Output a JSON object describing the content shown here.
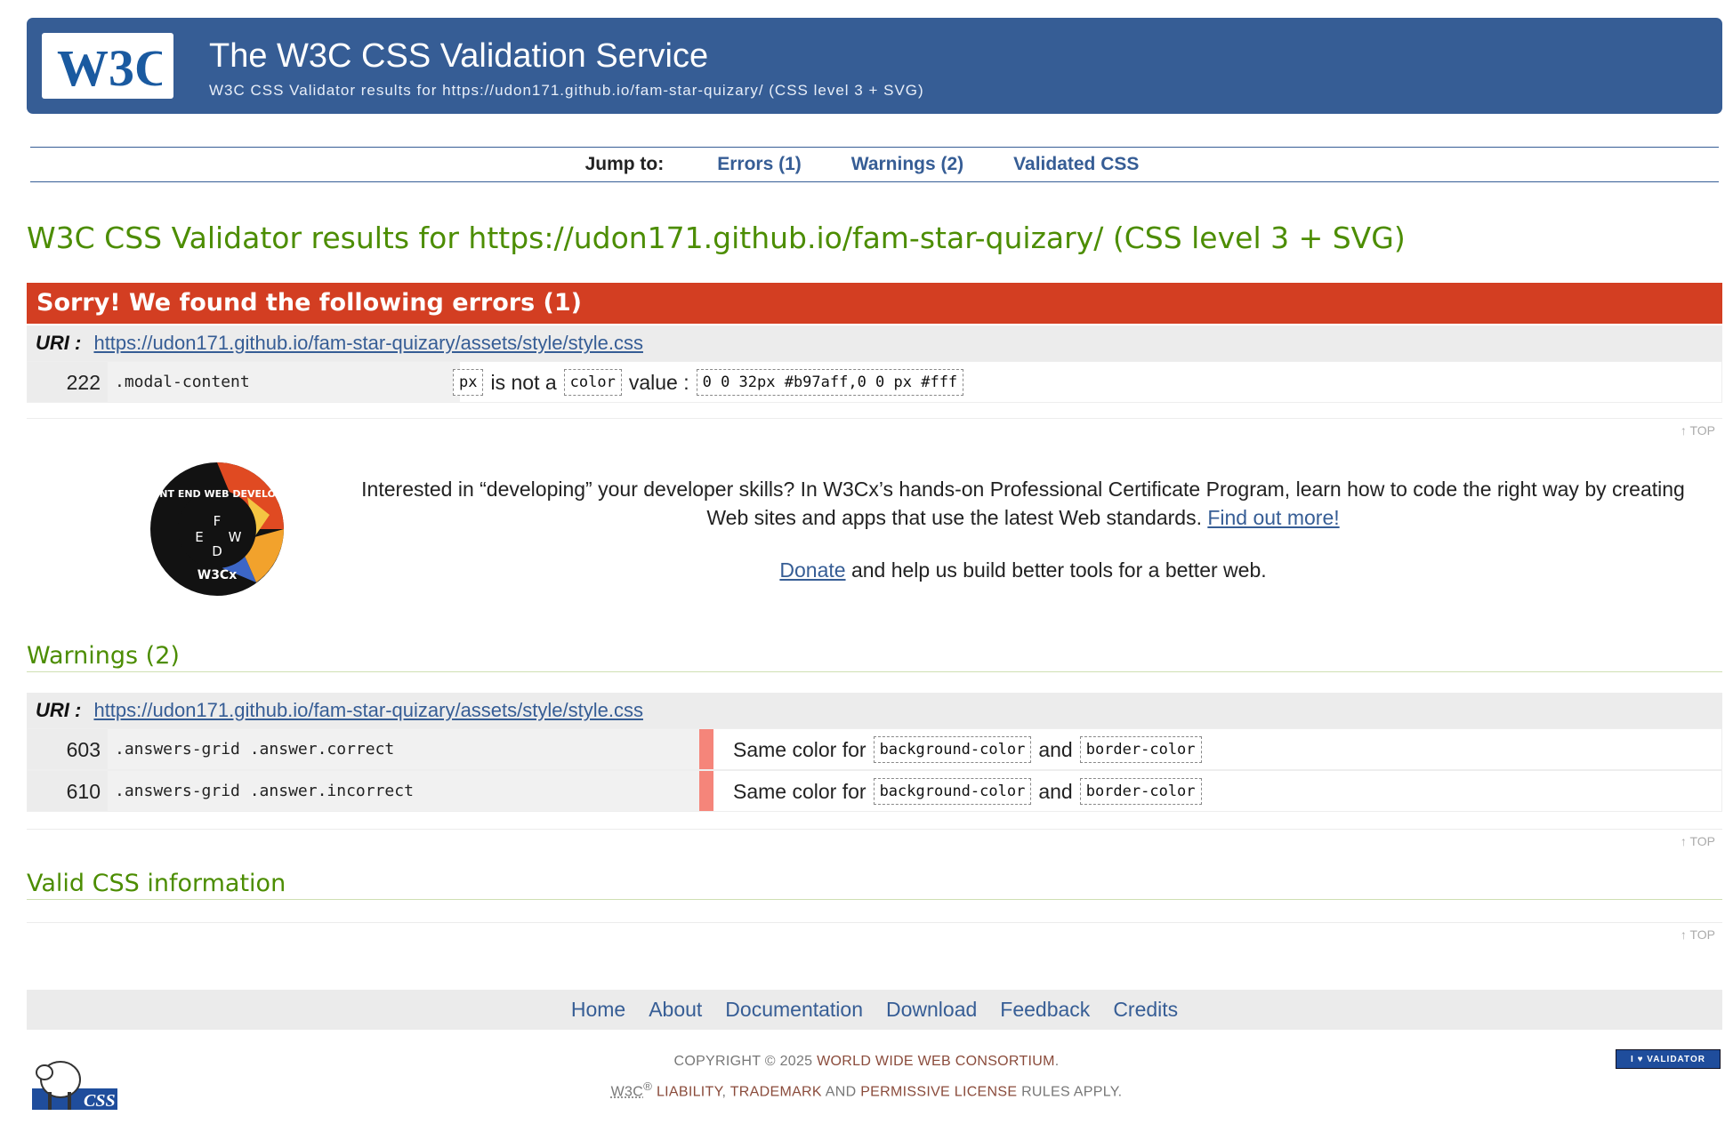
{
  "header": {
    "logo_text": "W3C",
    "title": "The W3C CSS Validation Service",
    "subtitle": "W3C CSS Validator results for https://udon171.github.io/fam-star-quizary/ (CSS level 3 + SVG)"
  },
  "jump": {
    "label": "Jump to:",
    "errors": "Errors (1)",
    "warnings": "Warnings (2)",
    "validated": "Validated CSS"
  },
  "results_title": "W3C CSS Validator results for https://udon171.github.io/fam-star-quizary/ (CSS level 3 + SVG)",
  "errors": {
    "heading": "Sorry! We found the following errors (1)",
    "uri_label": "URI :",
    "uri": "https://udon171.github.io/fam-star-quizary/assets/style/style.css",
    "rows": [
      {
        "line": "222",
        "selector": ".modal-content",
        "code1": "px",
        "text1": "is not a",
        "code2": "color",
        "text2": "value :",
        "code3": "0 0 32px #b97aff,0 0 px #fff"
      }
    ]
  },
  "top_label": "TOP",
  "promo": {
    "badge_text": "FRONT END WEB DEVELOPER",
    "badge_logo": "W3Cx",
    "text": "Interested in “developing” your developer skills? In W3Cx’s hands-on Professional Certificate Program, learn how to code the right way by creating Web sites and apps that use the latest Web standards.",
    "link": "Find out more!",
    "donate_link": "Donate",
    "donate_text": "and help us build better tools for a better web."
  },
  "warnings": {
    "heading": "Warnings (2)",
    "uri_label": "URI :",
    "uri": "https://udon171.github.io/fam-star-quizary/assets/style/style.css",
    "rows": [
      {
        "line": "603",
        "selector": ".answers-grid .answer.correct",
        "text1": "Same color for",
        "code1": "background-color",
        "text2": "and",
        "code2": "border-color"
      },
      {
        "line": "610",
        "selector": ".answers-grid .answer.incorrect",
        "text1": "Same color for",
        "code1": "background-color",
        "text2": "and",
        "code2": "border-color"
      }
    ]
  },
  "valid_heading": "Valid CSS information",
  "footer": {
    "links": [
      "Home",
      "About",
      "Documentation",
      "Download",
      "Feedback",
      "Credits"
    ],
    "copyright_prefix": "COPYRIGHT © 2025",
    "copyright_org": "WORLD WIDE WEB CONSORTIUM",
    "w3c": "W3C",
    "reg": "®",
    "liability": "LIABILITY",
    "trademark": "TRADEMARK",
    "and": "AND",
    "permissive": "PERMISSIVE LICENSE",
    "rules": "RULES APPLY.",
    "jigsaw_text": "CSS",
    "ilove": "I ♥ VALIDATOR"
  },
  "colors": {
    "banner": "#365d95",
    "error_head": "#d33e22",
    "heading_green": "#4c8d02",
    "warning_bar": "#f5857a"
  }
}
